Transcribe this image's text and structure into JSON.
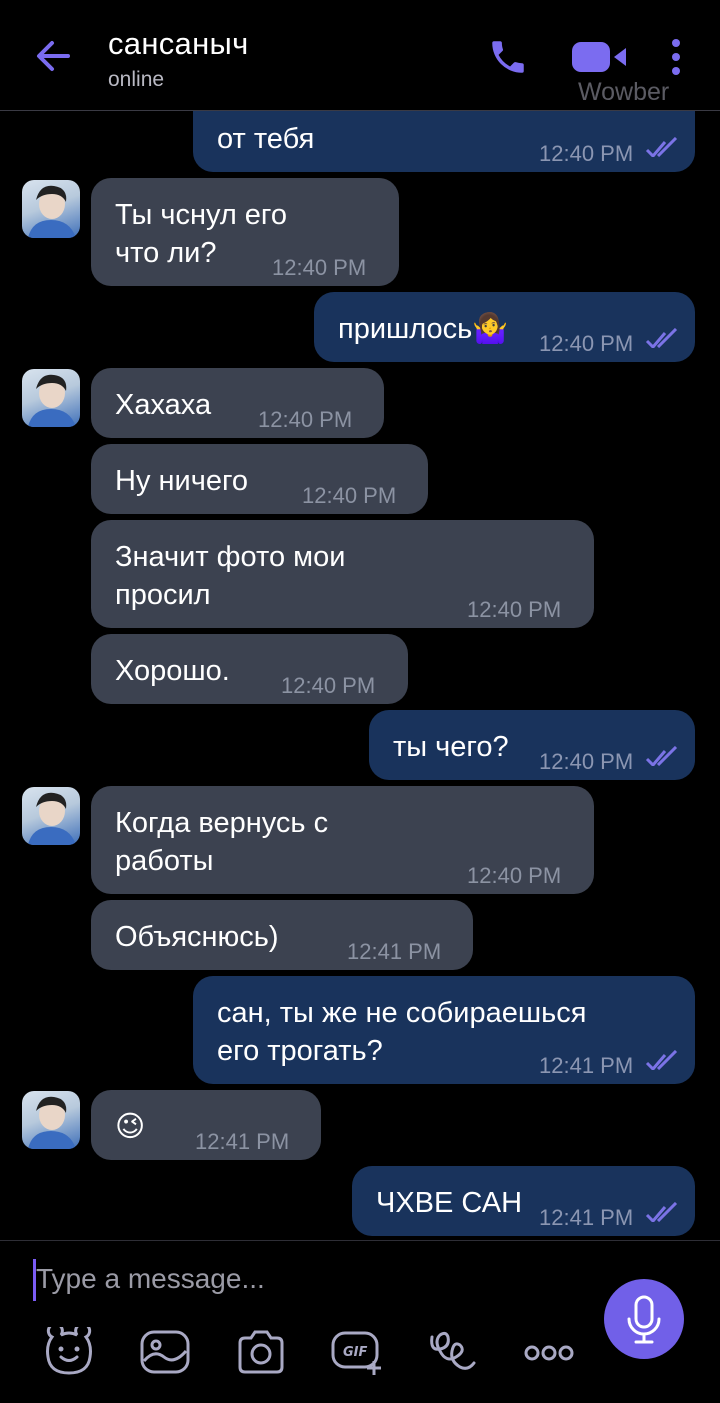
{
  "header": {
    "contact_name": "сансаныч",
    "status": "online",
    "watermark": "Wowber"
  },
  "messages": [
    {
      "dir": "out",
      "lines": [
        "от тебя"
      ],
      "time": "12:40 PM",
      "partial_top": true
    },
    {
      "dir": "in",
      "lines": [
        "Ты чснул его",
        "что ли?"
      ],
      "time": "12:40 PM",
      "avatar": true
    },
    {
      "dir": "out",
      "lines": [
        "пришлось🤷‍♀️"
      ],
      "time": "12:40 PM"
    },
    {
      "dir": "in",
      "lines": [
        "Хахаха"
      ],
      "time": "12:40 PM",
      "avatar": true
    },
    {
      "dir": "in",
      "lines": [
        "Ну ничего"
      ],
      "time": "12:40 PM"
    },
    {
      "dir": "in",
      "lines": [
        "Значит фото мои",
        "просил"
      ],
      "time": "12:40 PM"
    },
    {
      "dir": "in",
      "lines": [
        "Хорошо."
      ],
      "time": "12:40 PM"
    },
    {
      "dir": "out",
      "lines": [
        "ты чего?"
      ],
      "time": "12:40 PM"
    },
    {
      "dir": "in",
      "lines": [
        "Когда вернусь с",
        "работы"
      ],
      "time": "12:40 PM",
      "avatar": true
    },
    {
      "dir": "in",
      "lines": [
        "Объяснюсь)"
      ],
      "time": "12:41 PM"
    },
    {
      "dir": "out",
      "lines": [
        "сан, ты же не собираешься",
        "его трогать?"
      ],
      "time": "12:41 PM"
    },
    {
      "dir": "in",
      "lines": [
        "😉"
      ],
      "time": "12:41 PM",
      "avatar": true
    },
    {
      "dir": "out",
      "lines": [
        "ЧХВЕ САН"
      ],
      "time": "12:41 PM"
    }
  ],
  "composer": {
    "placeholder": "Type a message...",
    "toolbar_icons": [
      "sticker-icon",
      "gallery-icon",
      "camera-icon",
      "gif-icon",
      "doodle-icon",
      "more-icon"
    ]
  },
  "colors": {
    "accent": "#7160e8",
    "incoming_bubble": "#3c4250",
    "outgoing_bubble": "#19335c",
    "background": "#000000"
  }
}
